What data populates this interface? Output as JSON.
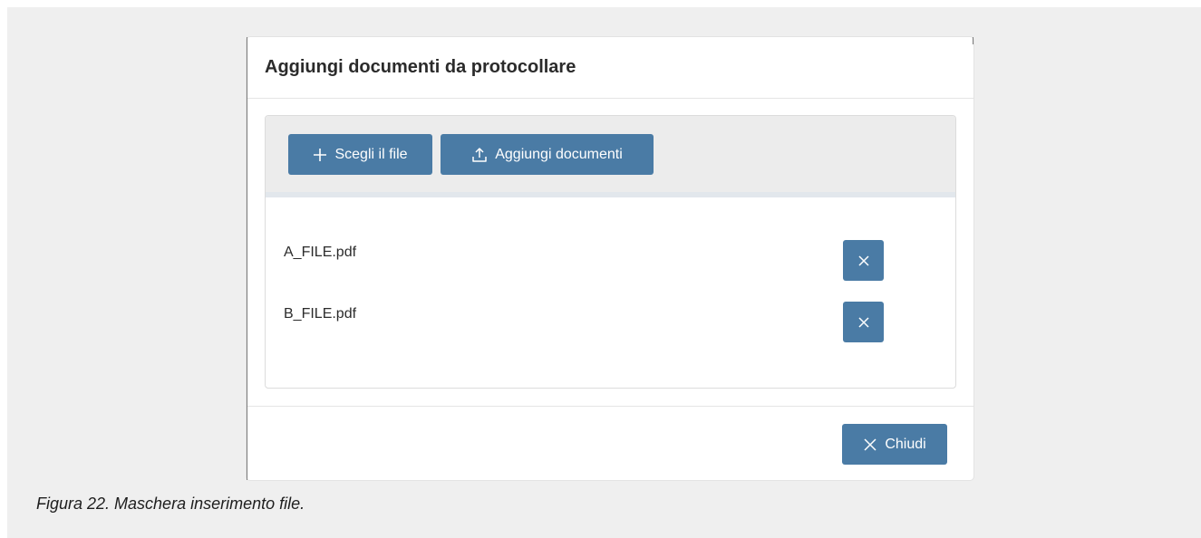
{
  "dialog": {
    "title": "Aggiungi documenti da protocollare",
    "toolbar": {
      "choose_label": "Scegli il file",
      "choose_icon": "plus-icon",
      "upload_label": "Aggiungi documenti",
      "upload_icon": "upload-icon"
    },
    "files": [
      {
        "name": "A_FILE.pdf"
      },
      {
        "name": "B_FILE.pdf"
      }
    ],
    "footer": {
      "close_label": "Chiudi",
      "close_icon": "close-icon"
    }
  },
  "caption": "Figura 22. Maschera inserimento file.",
  "colors": {
    "accent": "#4a7ba5",
    "background": "#efefef",
    "toolbar": "#ececec"
  }
}
